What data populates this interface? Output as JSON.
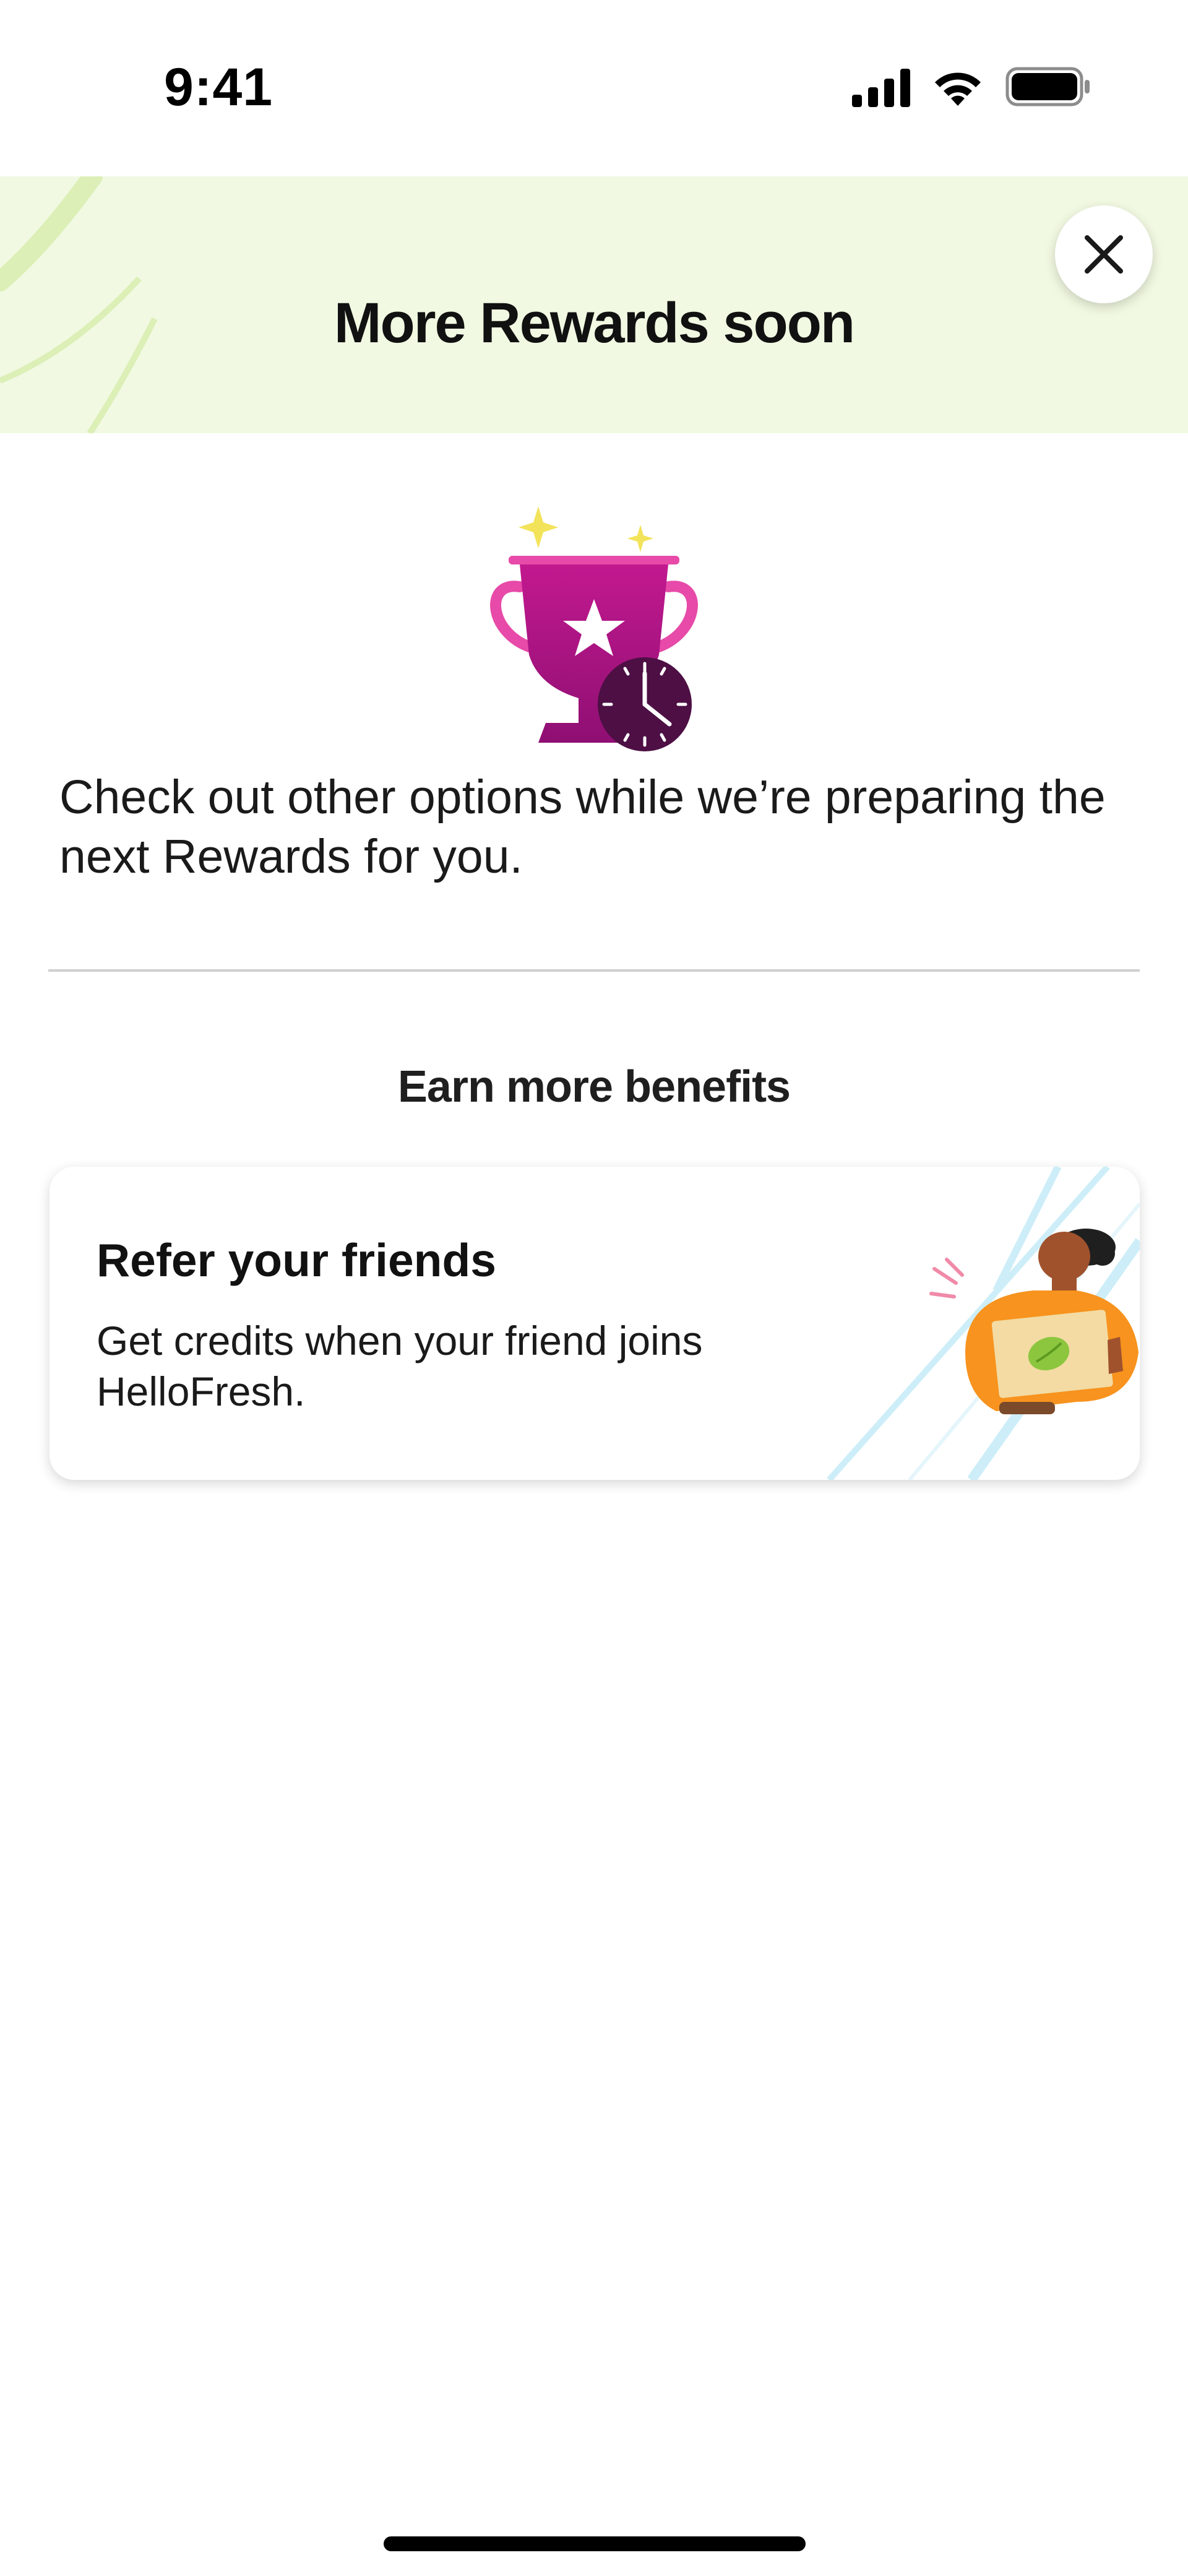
{
  "status_bar": {
    "time": "9:41"
  },
  "header": {
    "title": "More Rewards soon",
    "close_icon": "close-icon"
  },
  "intro": {
    "text": "Check out other options while we’re preparing the next Rewards for you."
  },
  "benefits": {
    "section_title": "Earn more benefits",
    "card": {
      "title": "Refer your friends",
      "description": "Get credits when your friend joins HelloFresh."
    }
  },
  "colors": {
    "header_bg": "#f1f9e2",
    "trophy": "#a0117f",
    "clock": "#4d0f44",
    "sparkle": "#f2e35a",
    "accent_orange": "#f7931e"
  }
}
